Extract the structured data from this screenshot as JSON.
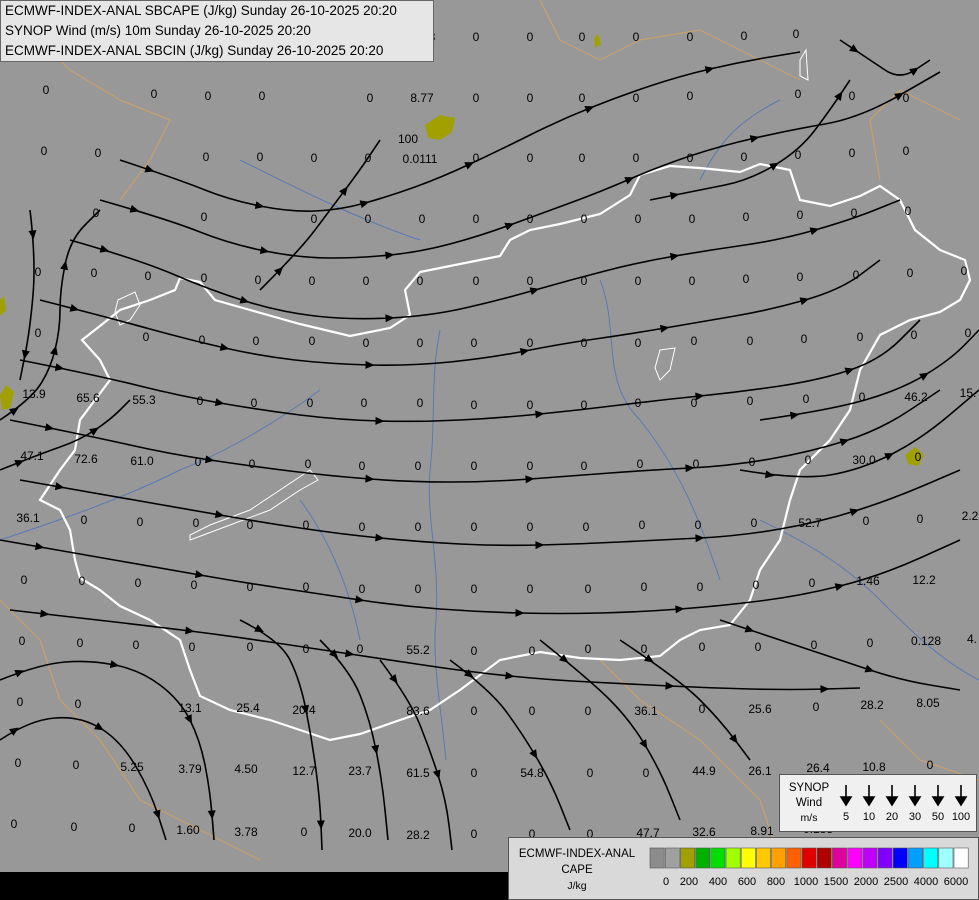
{
  "titles": [
    "ECMWF-INDEX-ANAL SBCAPE (J/kg) Sunday 26-10-2025 20:20",
    "SYNOP Wind (m/s) 10m Sunday 26-10-2025 20:20",
    "ECMWF-INDEX-ANAL SBCIN (J/kg) Sunday 26-10-2025 20:20"
  ],
  "synop_legend": {
    "title_lines": [
      "SYNOP",
      "Wind",
      "m/s"
    ],
    "speeds": [
      "5",
      "10",
      "20",
      "30",
      "50",
      "100"
    ]
  },
  "cape_legend": {
    "title_lines": [
      "ECMWF-INDEX-ANAL",
      "CAPE",
      "J/kg"
    ],
    "colors": [
      "#8c8c8c",
      "#a0a0a0",
      "#a0a000",
      "#00b000",
      "#00e000",
      "#a0ff00",
      "#ffff00",
      "#ffc800",
      "#ffa000",
      "#ff6000",
      "#e00000",
      "#b00000",
      "#e000a0",
      "#ff00ff",
      "#c000ff",
      "#8000ff",
      "#0000ff",
      "#00a0ff",
      "#00ffff",
      "#a0ffff",
      "#ffffff"
    ],
    "ticks": [
      "0",
      "200",
      "400",
      "600",
      "800",
      "1000",
      "1500",
      "2000",
      "2500",
      "4000",
      "6000"
    ]
  },
  "map": {
    "background": "#989898",
    "river_color": "#5a7ab4",
    "border_color": "#ffffff",
    "cape_patch_color": "#a0a000",
    "labels": [
      [
        "0",
        46,
        90
      ],
      [
        "0",
        154,
        94
      ],
      [
        "0",
        208,
        96
      ],
      [
        "0",
        262,
        96
      ],
      [
        "0",
        370,
        98
      ],
      [
        "8.77",
        422,
        98
      ],
      [
        "0",
        476,
        98
      ],
      [
        "0",
        530,
        98
      ],
      [
        "0",
        582,
        98
      ],
      [
        "0",
        636,
        98
      ],
      [
        "0",
        690,
        96
      ],
      [
        "0",
        744,
        36
      ],
      [
        "0",
        798,
        94
      ],
      [
        "0",
        852,
        96
      ],
      [
        "0",
        906,
        98
      ],
      [
        "0",
        260,
        37
      ],
      [
        "0",
        314,
        37
      ],
      [
        "4e-08",
        420,
        37
      ],
      [
        "0",
        476,
        37
      ],
      [
        "0",
        530,
        37
      ],
      [
        "0",
        582,
        37
      ],
      [
        "0",
        636,
        37
      ],
      [
        "0",
        690,
        37
      ],
      [
        "0",
        796,
        34
      ],
      [
        "100",
        408,
        139
      ],
      [
        "0.0111",
        420,
        159
      ],
      [
        "0",
        44,
        151
      ],
      [
        "0",
        98,
        153
      ],
      [
        "0",
        206,
        157
      ],
      [
        "0",
        260,
        157
      ],
      [
        "0",
        314,
        158
      ],
      [
        "0",
        368,
        158
      ],
      [
        "0",
        476,
        158
      ],
      [
        "0",
        530,
        158
      ],
      [
        "0",
        582,
        158
      ],
      [
        "0",
        636,
        158
      ],
      [
        "0",
        690,
        158
      ],
      [
        "0",
        744,
        157
      ],
      [
        "0",
        798,
        155
      ],
      [
        "0",
        852,
        153
      ],
      [
        "0",
        906,
        151
      ],
      [
        "0",
        96,
        213
      ],
      [
        "0",
        204,
        217
      ],
      [
        "0",
        314,
        219
      ],
      [
        "0",
        368,
        219
      ],
      [
        "0",
        422,
        219
      ],
      [
        "0",
        476,
        219
      ],
      [
        "0",
        530,
        219
      ],
      [
        "0",
        584,
        219
      ],
      [
        "0",
        638,
        219
      ],
      [
        "0",
        692,
        219
      ],
      [
        "0",
        746,
        217
      ],
      [
        "0",
        800,
        215
      ],
      [
        "0",
        854,
        213
      ],
      [
        "0",
        908,
        211
      ],
      [
        "0",
        38,
        272
      ],
      [
        "0",
        94,
        273
      ],
      [
        "0",
        148,
        276
      ],
      [
        "0",
        204,
        278
      ],
      [
        "0",
        258,
        280
      ],
      [
        "0",
        312,
        281
      ],
      [
        "0",
        366,
        281
      ],
      [
        "0",
        420,
        281
      ],
      [
        "0",
        476,
        281
      ],
      [
        "0",
        530,
        281
      ],
      [
        "0",
        584,
        281
      ],
      [
        "0",
        638,
        281
      ],
      [
        "0",
        692,
        281
      ],
      [
        "0",
        746,
        279
      ],
      [
        "0",
        800,
        277
      ],
      [
        "0",
        856,
        275
      ],
      [
        "0",
        910,
        273
      ],
      [
        "0",
        964,
        271
      ],
      [
        "0",
        38,
        333
      ],
      [
        "0",
        146,
        337
      ],
      [
        "0",
        202,
        340
      ],
      [
        "0",
        256,
        341
      ],
      [
        "0",
        312,
        341
      ],
      [
        "0",
        366,
        343
      ],
      [
        "0",
        420,
        343
      ],
      [
        "0",
        474,
        343
      ],
      [
        "0",
        530,
        343
      ],
      [
        "0",
        584,
        343
      ],
      [
        "0",
        638,
        343
      ],
      [
        "0",
        694,
        341
      ],
      [
        "0",
        750,
        341
      ],
      [
        "0",
        804,
        339
      ],
      [
        "0",
        860,
        337
      ],
      [
        "0",
        914,
        335
      ],
      [
        "0",
        968,
        333
      ],
      [
        "13.9",
        34,
        394
      ],
      [
        "65.6",
        88,
        398
      ],
      [
        "55.3",
        144,
        400
      ],
      [
        "0",
        200,
        401
      ],
      [
        "0",
        254,
        403
      ],
      [
        "0",
        310,
        403
      ],
      [
        "0",
        364,
        403
      ],
      [
        "0",
        420,
        403
      ],
      [
        "0",
        474,
        405
      ],
      [
        "0",
        530,
        405
      ],
      [
        "0",
        584,
        405
      ],
      [
        "0",
        638,
        403
      ],
      [
        "0",
        694,
        403
      ],
      [
        "0",
        750,
        401
      ],
      [
        "0",
        806,
        399
      ],
      [
        "0",
        862,
        397
      ],
      [
        "46.2",
        916,
        397
      ],
      [
        "15.",
        968,
        393
      ],
      [
        "47.1",
        32,
        456
      ],
      [
        "72.6",
        86,
        459
      ],
      [
        "61.0",
        142,
        461
      ],
      [
        "0",
        198,
        462
      ],
      [
        "0",
        252,
        464
      ],
      [
        "0",
        308,
        464
      ],
      [
        "0",
        362,
        466
      ],
      [
        "0",
        418,
        466
      ],
      [
        "0",
        474,
        466
      ],
      [
        "0",
        530,
        466
      ],
      [
        "0",
        584,
        466
      ],
      [
        "0",
        640,
        464
      ],
      [
        "0",
        696,
        464
      ],
      [
        "0",
        752,
        462
      ],
      [
        "0",
        808,
        460
      ],
      [
        "30.0",
        864,
        460
      ],
      [
        "0",
        918,
        457
      ],
      [
        "36.1",
        28,
        518
      ],
      [
        "0",
        84,
        520
      ],
      [
        "0",
        140,
        522
      ],
      [
        "0",
        196,
        523
      ],
      [
        "0",
        250,
        525
      ],
      [
        "0",
        306,
        525
      ],
      [
        "0",
        362,
        527
      ],
      [
        "0",
        418,
        527
      ],
      [
        "0",
        474,
        527
      ],
      [
        "0",
        530,
        527
      ],
      [
        "0",
        586,
        527
      ],
      [
        "0",
        642,
        525
      ],
      [
        "0",
        698,
        525
      ],
      [
        "0",
        754,
        523
      ],
      [
        "52.7",
        810,
        523
      ],
      [
        "0",
        866,
        521
      ],
      [
        "0",
        920,
        519
      ],
      [
        "2.2",
        970,
        516
      ],
      [
        "0",
        24,
        580
      ],
      [
        "0",
        82,
        581
      ],
      [
        "0",
        138,
        583
      ],
      [
        "0",
        194,
        585
      ],
      [
        "0",
        250,
        587
      ],
      [
        "0",
        306,
        587
      ],
      [
        "0",
        362,
        589
      ],
      [
        "0",
        418,
        589
      ],
      [
        "0",
        474,
        589
      ],
      [
        "0",
        530,
        589
      ],
      [
        "0",
        588,
        589
      ],
      [
        "0",
        644,
        587
      ],
      [
        "0",
        700,
        587
      ],
      [
        "0",
        756,
        585
      ],
      [
        "0",
        812,
        583
      ],
      [
        "1.46",
        868,
        581
      ],
      [
        "12.2",
        924,
        580
      ],
      [
        "0",
        22,
        641
      ],
      [
        "0",
        80,
        643
      ],
      [
        "0",
        136,
        645
      ],
      [
        "0",
        192,
        647
      ],
      [
        "0",
        250,
        647
      ],
      [
        "0",
        306,
        649
      ],
      [
        "0",
        360,
        649
      ],
      [
        "55.2",
        418,
        650
      ],
      [
        "0",
        474,
        651
      ],
      [
        "0",
        532,
        651
      ],
      [
        "0",
        588,
        649
      ],
      [
        "0",
        644,
        649
      ],
      [
        "0",
        702,
        647
      ],
      [
        "0",
        758,
        647
      ],
      [
        "0",
        814,
        645
      ],
      [
        "0",
        870,
        643
      ],
      [
        "0.128",
        926,
        641
      ],
      [
        "4.",
        972,
        639
      ],
      [
        "0",
        20,
        702
      ],
      [
        "0",
        78,
        704
      ],
      [
        "13.1",
        190,
        708
      ],
      [
        "25.4",
        248,
        708
      ],
      [
        "20.4",
        304,
        710
      ],
      [
        "83.6",
        418,
        711
      ],
      [
        "0",
        474,
        711
      ],
      [
        "0",
        532,
        711
      ],
      [
        "0",
        588,
        711
      ],
      [
        "36.1",
        646,
        711
      ],
      [
        "0",
        702,
        709
      ],
      [
        "25.6",
        760,
        709
      ],
      [
        "0",
        816,
        707
      ],
      [
        "28.2",
        872,
        705
      ],
      [
        "8.05",
        928,
        703
      ],
      [
        "0",
        18,
        763
      ],
      [
        "0",
        76,
        765
      ],
      [
        "5.25",
        132,
        767
      ],
      [
        "3.79",
        190,
        769
      ],
      [
        "4.50",
        246,
        769
      ],
      [
        "12.7",
        304,
        771
      ],
      [
        "23.7",
        360,
        771
      ],
      [
        "61.5",
        418,
        773
      ],
      [
        "0",
        474,
        773
      ],
      [
        "54.8",
        532,
        773
      ],
      [
        "0",
        590,
        773
      ],
      [
        "0",
        646,
        773
      ],
      [
        "44.9",
        704,
        771
      ],
      [
        "26.1",
        760,
        771
      ],
      [
        "26.4",
        818,
        768
      ],
      [
        "10.8",
        874,
        767
      ],
      [
        "0",
        930,
        765
      ],
      [
        "0",
        14,
        824
      ],
      [
        "0",
        74,
        827
      ],
      [
        "0",
        132,
        828
      ],
      [
        "1.60",
        188,
        830
      ],
      [
        "3.78",
        246,
        832
      ],
      [
        "0",
        304,
        832
      ],
      [
        "20.0",
        360,
        833
      ],
      [
        "28.2",
        418,
        835
      ],
      [
        "0",
        474,
        834
      ],
      [
        "0",
        532,
        834
      ],
      [
        "0",
        590,
        834
      ],
      [
        "47.7",
        648,
        833
      ],
      [
        "32.6",
        704,
        832
      ],
      [
        "8.91",
        762,
        831
      ],
      [
        "0.188",
        818,
        829
      ],
      [
        "0",
        876,
        828
      ],
      [
        "0",
        930,
        826
      ]
    ]
  }
}
